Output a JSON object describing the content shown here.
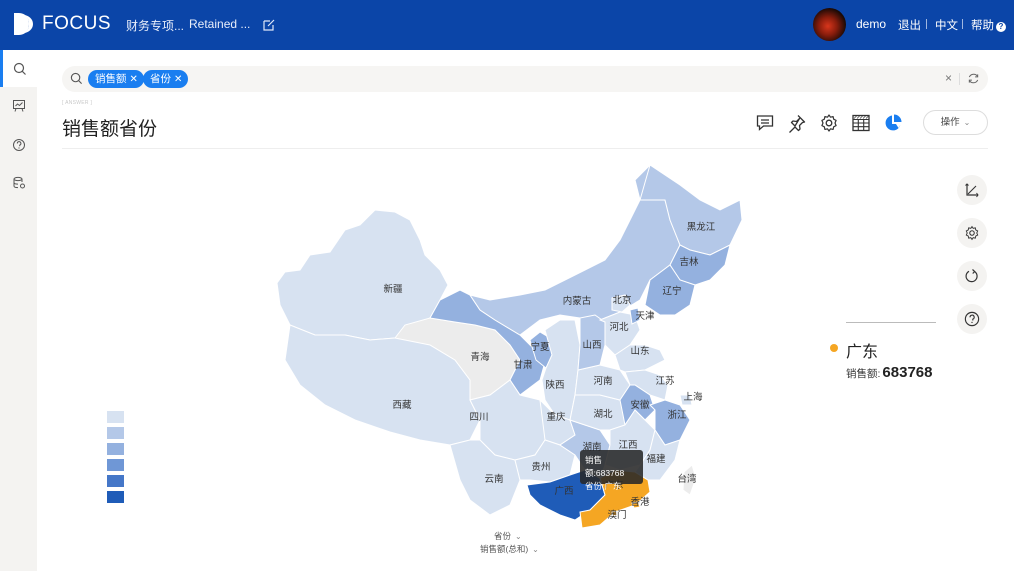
{
  "app": {
    "brand": "FOCUS",
    "nav": [
      "财务专项...",
      "Retained ..."
    ],
    "user": "demo",
    "links": {
      "logout": "退出",
      "lang": "中文",
      "help": "帮助",
      "help_mark": "?"
    }
  },
  "search": {
    "chips": [
      {
        "label": "销售额",
        "close": "✕"
      },
      {
        "label": "省份",
        "close": "✕"
      }
    ],
    "clear": "×"
  },
  "answer": {
    "tag": "[ ANSWER ]",
    "title": "销售额省份",
    "ops_label": "操作"
  },
  "colors": {
    "brand": "#0b45a8",
    "accent": "#1a7ef0",
    "highlight": "#f5a623",
    "scale": [
      "#d7e2f1",
      "#b4c8e8",
      "#94b1df",
      "#6f97d6",
      "#4577c8",
      "#1f5cb8"
    ]
  },
  "chart_data": {
    "type": "map",
    "region": "China provinces",
    "metric": "销售额",
    "dimension": "省份",
    "legend": {
      "type": "piecewise",
      "pieces": 6,
      "placement": "bottom-left"
    },
    "provinces": [
      {
        "name": "新疆",
        "level": 1
      },
      {
        "name": "西藏",
        "level": 1
      },
      {
        "name": "青海",
        "level": 0
      },
      {
        "name": "甘肃",
        "level": 3
      },
      {
        "name": "内蒙古",
        "level": 2
      },
      {
        "name": "宁夏",
        "level": 3
      },
      {
        "name": "陕西",
        "level": 1
      },
      {
        "name": "四川",
        "level": 1
      },
      {
        "name": "重庆",
        "level": 1
      },
      {
        "name": "云南",
        "level": 1
      },
      {
        "name": "贵州",
        "level": 1
      },
      {
        "name": "广西",
        "level": 6
      },
      {
        "name": "广东",
        "level": 7,
        "value": 683768,
        "selected": true
      },
      {
        "name": "湖南",
        "level": 2
      },
      {
        "name": "湖北",
        "level": 1
      },
      {
        "name": "河南",
        "level": 1
      },
      {
        "name": "山西",
        "level": 2
      },
      {
        "name": "河北",
        "level": 1
      },
      {
        "name": "北京",
        "level": 1
      },
      {
        "name": "天津",
        "level": 3
      },
      {
        "name": "山东",
        "level": 1
      },
      {
        "name": "江苏",
        "level": 1
      },
      {
        "name": "安徽",
        "level": 3
      },
      {
        "name": "浙江",
        "level": 3
      },
      {
        "name": "上海",
        "level": 1
      },
      {
        "name": "江西",
        "level": 1
      },
      {
        "name": "福建",
        "level": 1
      },
      {
        "name": "台湾",
        "level": 0
      },
      {
        "name": "香港",
        "level": 7
      },
      {
        "name": "澳门",
        "level": 7
      },
      {
        "name": "黑龙江",
        "level": 2
      },
      {
        "name": "吉林",
        "level": 3
      },
      {
        "name": "辽宁",
        "level": 3
      }
    ]
  },
  "tooltip": {
    "line1": "销售额:683768",
    "line2": "省份:广东"
  },
  "detail": {
    "name": "广东",
    "metric_label": "销售额:",
    "value": "683768"
  },
  "axes": {
    "dimension_select": "省份",
    "measure_select": "销售额(总和)"
  }
}
